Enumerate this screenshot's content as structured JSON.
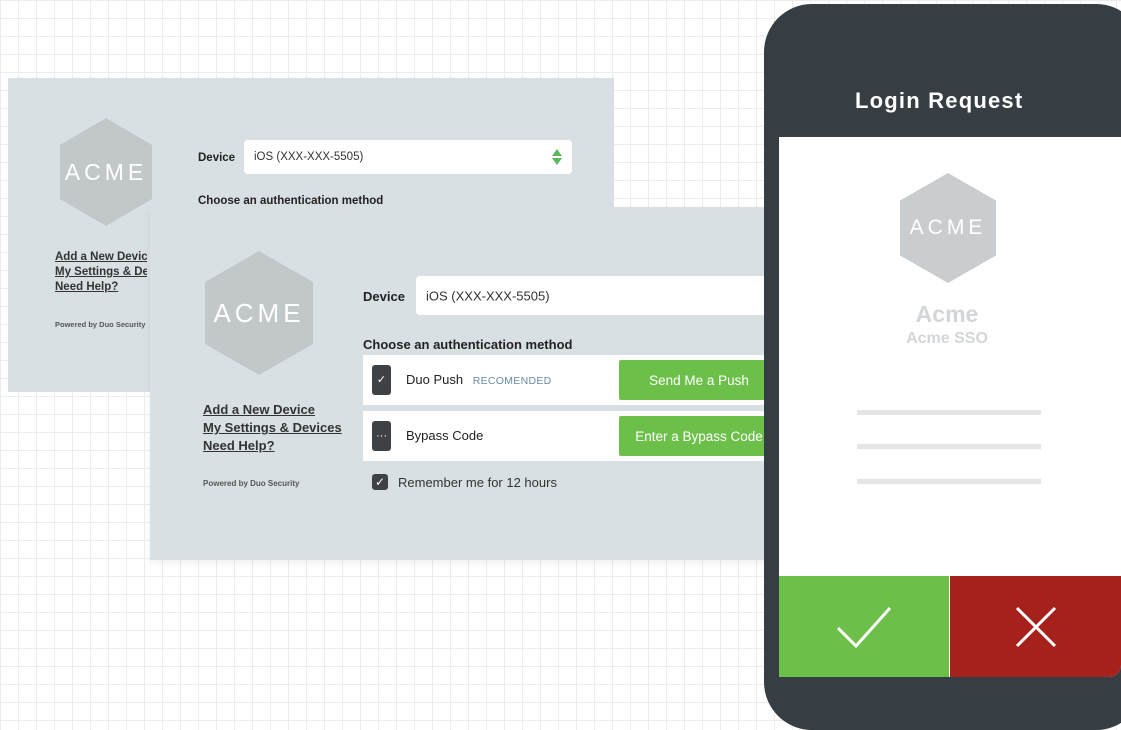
{
  "back_panel": {
    "logo_text": "ACME",
    "device_label": "Device",
    "device_value": "iOS (XXX-XXX-5505)",
    "choose_label": "Choose an authentication method",
    "links": [
      "Add a New Device",
      "My Settings & Devices",
      "Need Help?"
    ],
    "powered_by": "Powered by Duo Security"
  },
  "front_panel": {
    "logo_text": "ACME",
    "device_label": "Device",
    "device_value": "iOS (XXX-XXX-5505)",
    "choose_label": "Choose an authentication method",
    "methods": [
      {
        "label": "Duo Push",
        "tag": "RECOMENDED",
        "button": "Send Me a Push",
        "icon": "phone-check-icon"
      },
      {
        "label": "Bypass Code",
        "tag": "",
        "button": "Enter a Bypass Code",
        "icon": "phone-dots-icon"
      }
    ],
    "remember_label": "Remember me for 12 hours",
    "remember_checked": true,
    "links": [
      "Add a New Device",
      "My Settings & Devices",
      "Need Help?"
    ],
    "powered_by": "Powered by Duo Security"
  },
  "phone": {
    "title": "Login Request",
    "logo_text": "ACME",
    "app_name": "Acme",
    "app_sub": "Acme SSO",
    "approve_icon": "check-icon",
    "deny_icon": "x-icon"
  },
  "colors": {
    "accent_green": "#6cc04a",
    "deny_red": "#a7211c",
    "panel_bg": "#d9e0e3",
    "phone_body": "#363d43"
  }
}
